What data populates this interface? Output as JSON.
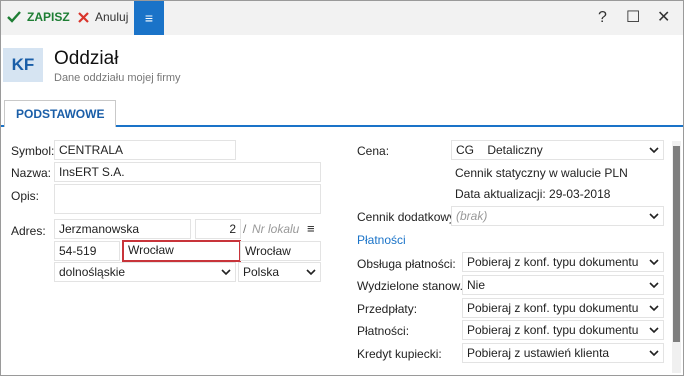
{
  "toolbar": {
    "save_label": "ZAPISZ",
    "cancel_label": "Anuluj",
    "menu_glyph": "≡",
    "help_glyph": "?",
    "maximize_glyph": "☐",
    "close_glyph": "✕"
  },
  "header": {
    "badge": "KF",
    "title": "Oddział",
    "subtitle": "Dane oddziału mojej firmy"
  },
  "tabs": [
    {
      "label": "PODSTAWOWE"
    }
  ],
  "left": {
    "symbol": {
      "label": "Symbol:",
      "value": "CENTRALA"
    },
    "nazwa": {
      "label": "Nazwa:",
      "value": "InsERT S.A."
    },
    "opis": {
      "label": "Opis:",
      "value": ""
    },
    "adres": {
      "label": "Adres:",
      "street": "Jerzmanowska",
      "number": "2",
      "separator": "/",
      "local_placeholder": "Nr lokalu",
      "menu_glyph": "≡",
      "postal": "54-519",
      "city_focused": "Wrocław",
      "post_city": "Wrocław",
      "region": "dolnośląskie",
      "country": "Polska"
    }
  },
  "right": {
    "cena": {
      "label": "Cena:",
      "code": "CG",
      "value": "Detaliczny"
    },
    "cennik_info": "Cennik statyczny w walucie PLN",
    "data_aktualizacji": "Data aktualizacji: 29-03-2018",
    "cennik_dodatkowy": {
      "label": "Cennik dodatkowy:",
      "placeholder": "(brak)"
    },
    "platnosci_link": "Płatności",
    "obsluga": {
      "label": "Obsługa płatności:",
      "value": "Pobieraj z konf. typu dokumentu"
    },
    "wydzielone": {
      "label": "Wydzielone stanow...",
      "value": "Nie"
    },
    "przedplaty": {
      "label": "Przedpłaty:",
      "value": "Pobieraj z konf. typu dokumentu"
    },
    "platnosci": {
      "label": "Płatności:",
      "value": "Pobieraj z konf. typu dokumentu"
    },
    "kredyt": {
      "label": "Kredyt kupiecki:",
      "value": "Pobieraj z ustawień klienta"
    }
  },
  "icons": {
    "save": "check-icon",
    "cancel": "x-icon",
    "dropdown": "chevron-down-icon"
  },
  "colors": {
    "accent": "#1a73c8",
    "save_green": "#1e7e34",
    "cancel_red": "#d9342b",
    "focus_border": "#c8343a"
  }
}
